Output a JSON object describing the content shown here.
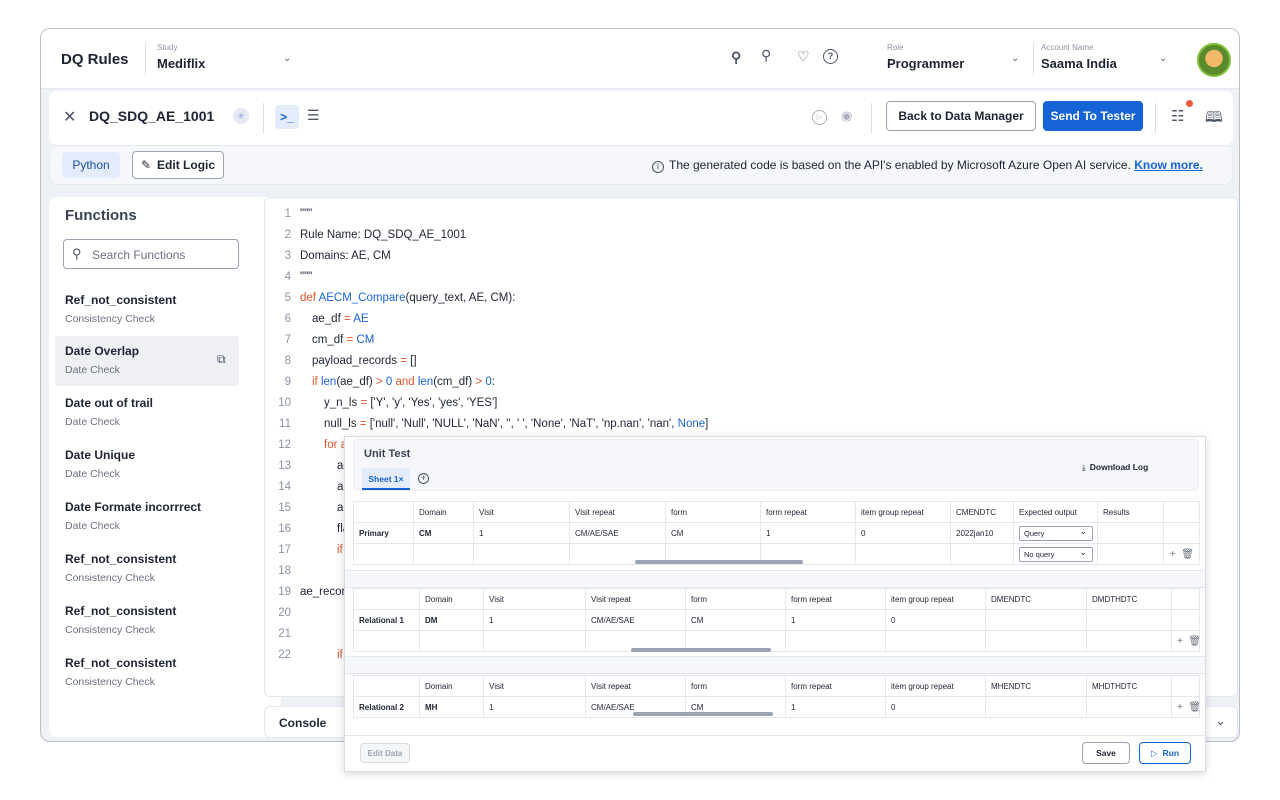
{
  "header": {
    "app_title": "DQ Rules",
    "study_label": "Study",
    "study_value": "Mediflix",
    "role_label": "Role",
    "role_value": "Programmer",
    "account_label": "Account Name",
    "account_value": "Saama India"
  },
  "rulebar": {
    "rule_name": "DQ_SDQ_AE_1001",
    "back_button": "Back to Data Manager",
    "send_button": "Send To Tester"
  },
  "infobar": {
    "language_tab": "Python",
    "edit_logic": "Edit Logic",
    "notice": "The generated code is based on the API's enabled by Microsoft Azure Open AI service.",
    "know_more": "Know more."
  },
  "functions": {
    "title": "Functions",
    "search_placeholder": "Search Functions",
    "items": [
      {
        "name": "Ref_not_consistent",
        "category": "Consistency Check"
      },
      {
        "name": "Date Overlap",
        "category": "Date Check"
      },
      {
        "name": "Date  out of trail",
        "category": "Date Check"
      },
      {
        "name": "Date Unique",
        "category": "Date Check"
      },
      {
        "name": "Date Formate incorrrect",
        "category": "Date Check"
      },
      {
        "name": "Ref_not_consistent",
        "category": "Consistency Check"
      },
      {
        "name": "Ref_not_consistent",
        "category": "Consistency Check"
      },
      {
        "name": "Ref_not_consistent",
        "category": "Consistency Check"
      }
    ]
  },
  "code": {
    "line_numbers": [
      "1",
      "2",
      "3",
      "4",
      "5",
      "6",
      "7",
      "8",
      "9",
      "10",
      "11",
      "12",
      "13",
      "14",
      "15",
      "16",
      "17",
      "18",
      "19",
      "20",
      "21",
      "22"
    ],
    "lines": {
      "l1": "\"\"\"",
      "l2": "Rule Name: DQ_SDQ_AE_1001",
      "l3": "Domains: AE, CM",
      "l4": "\"\"\"",
      "l5_def": "def ",
      "l5_fn": "AECM_Compare",
      "l5_rest": "(query_text, AE, CM):",
      "l6_a": "ae_df ",
      "l6_eq": "= ",
      "l6_b": "AE",
      "l7_a": "cm_df ",
      "l7_eq": "= ",
      "l7_b": "CM",
      "l8_a": "payload_records ",
      "l8_eq": "= ",
      "l8_b": "[]",
      "l9_if": "if ",
      "l9_len": "len",
      "l9_a": "(ae_df) ",
      "l9_gt": "> ",
      "l9_z": "0 ",
      "l9_and": "and ",
      "l9_len2": "len",
      "l9_b": "(cm_df) ",
      "l9_gt2": "> ",
      "l9_z2": "0",
      "l9_c": ":",
      "l10_a": "y_n_ls ",
      "l10_eq": "= ",
      "l10_b": "['Y', 'y', 'Yes', 'yes', 'YES']",
      "l11_a": "null_ls ",
      "l11_eq": "= ",
      "l11_b": "['null', 'Null', 'NULL', 'NaN', '', ' ', 'None', 'NaT', 'np.nan', 'nan', ",
      "l11_none": "None",
      "l11_c": "]",
      "l12": "for a",
      "l13": "ae",
      "l14": "ae",
      "l15": "ae",
      "l16": "fla",
      "l17": "if",
      "l19": "ae_recor",
      "l22": "if"
    }
  },
  "console": {
    "label": "Console"
  },
  "unit_test": {
    "title": "Unit Test",
    "sheet_tab": "Sheet 1",
    "download_log": "Download Log",
    "primary": {
      "role": "Primary",
      "headers": [
        "Domain",
        "Visit",
        "Visit repeat",
        "form",
        "form repeat",
        "item group repeat",
        "CMENDTC",
        "Expected output",
        "Results"
      ],
      "row1": [
        "CM",
        "1",
        "CM/AE/SAE",
        "CM",
        "1",
        "0",
        "2022jan10"
      ],
      "expected1": "Query",
      "expected2": "No query"
    },
    "relational1": {
      "role": "Relational 1",
      "headers": [
        "Domain",
        "Visit",
        "Visit repeat",
        "form",
        "form repeat",
        "item group repeat",
        "DMENDTC",
        "DMDTHDTC"
      ],
      "row1": [
        "DM",
        "1",
        "CM/AE/SAE",
        "CM",
        "1",
        "0"
      ]
    },
    "relational2": {
      "role": "Relational 2",
      "headers": [
        "Domain",
        "Visit",
        "Visit repeat",
        "form",
        "form repeat",
        "item group repeat",
        "MHENDTC",
        "MHDTHDTC"
      ],
      "row1": [
        "MH",
        "1",
        "CM/AE/SAE",
        "CM",
        "1",
        "0"
      ]
    },
    "edit_data": "Edit Data",
    "save": "Save",
    "run": "Run"
  },
  "colors": {
    "accent": "#1663d6",
    "keyword": "#e0552b",
    "notification": "#ef5a3c"
  }
}
